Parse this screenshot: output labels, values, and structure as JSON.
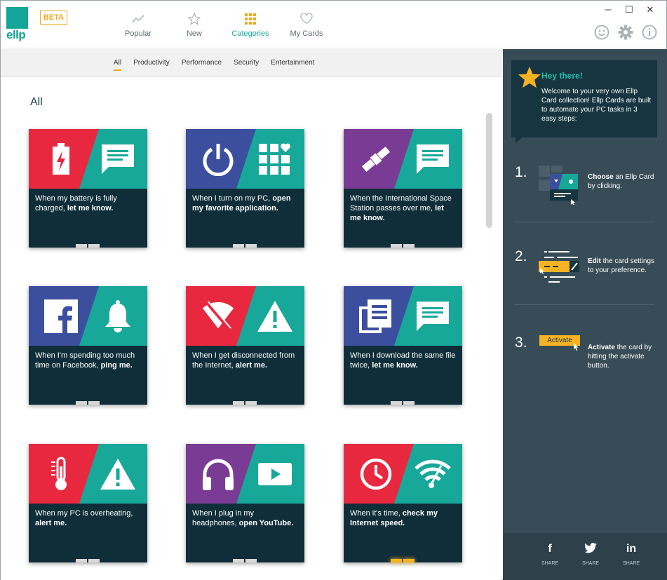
{
  "app": {
    "logo_text": "ellp",
    "beta_label": "BETA"
  },
  "nav": [
    {
      "label": "Popular",
      "icon": "trend-icon"
    },
    {
      "label": "New",
      "icon": "star-icon"
    },
    {
      "label": "Categories",
      "icon": "grid-icon",
      "active": true
    },
    {
      "label": "My Cards",
      "icon": "heart-icon"
    }
  ],
  "window_controls": {
    "minimize": "─",
    "maximize": "☐",
    "close": "✕"
  },
  "subnav": [
    "All",
    "Productivity",
    "Performance",
    "Security",
    "Entertainment"
  ],
  "heading": "All",
  "cards": [
    {
      "pre": "When my battery is fully charged, ",
      "bold": "let me know.",
      "left_icon": "battery-icon",
      "right_icon": "message-icon",
      "color": "red"
    },
    {
      "pre": "When I turn on my PC, ",
      "bold": "open my favorite application.",
      "left_icon": "power-icon",
      "right_icon": "apps-icon",
      "color": "blue"
    },
    {
      "pre": "When the International Space Station passes over me, ",
      "bold": "let me know.",
      "left_icon": "satellite-icon",
      "right_icon": "message-icon",
      "color": "purple"
    },
    {
      "pre": "When I'm spending too much time on Facebook, ",
      "bold": "ping me.",
      "left_icon": "facebook-icon",
      "right_icon": "bell-icon",
      "color": "blue"
    },
    {
      "pre": "When I get disconnected from the Internet, ",
      "bold": "alert me.",
      "left_icon": "no-wifi-icon",
      "right_icon": "warning-icon",
      "color": "red"
    },
    {
      "pre": "When I download the same file twice, ",
      "bold": "let me know.",
      "left_icon": "files-icon",
      "right_icon": "message-icon",
      "color": "blue"
    },
    {
      "pre": "When my PC is overheating, ",
      "bold": "alert me.",
      "left_icon": "thermometer-icon",
      "right_icon": "warning-icon",
      "color": "red"
    },
    {
      "pre": "When I plug in my headphones, ",
      "bold": "open YouTube.",
      "left_icon": "headphones-icon",
      "right_icon": "youtube-icon",
      "color": "purple"
    },
    {
      "pre": "When it's time, ",
      "bold": "check my Internet speed.",
      "left_icon": "clock-icon",
      "right_icon": "speed-icon",
      "color": "red"
    }
  ],
  "sidebar": {
    "title": "Hey there!",
    "welcome": "Welcome to your very own Ellp Card collection! Ellp Cards are built to automate your PC tasks in 3 easy steps:",
    "steps": [
      {
        "num": "1.",
        "bold": "Choose",
        "text": " an Ellp Card by clicking."
      },
      {
        "num": "2.",
        "bold": "Edit",
        "text": " the card settings to your preference."
      },
      {
        "num": "3.",
        "bold": "Activate",
        "text": " the card by hitting the activate button.",
        "button": "Activate"
      }
    ],
    "share": [
      {
        "icon": "f",
        "label": "SHARE"
      },
      {
        "icon": "t",
        "label": "SHARE"
      },
      {
        "icon": "in",
        "label": "SHARE"
      }
    ]
  }
}
